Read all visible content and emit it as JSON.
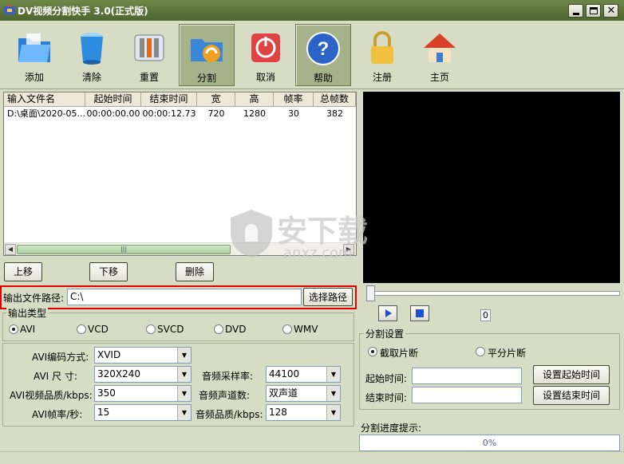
{
  "window": {
    "title": "DV视频分割快手 3.0(正式版)"
  },
  "toolbar": [
    {
      "name": "add",
      "label": "添加",
      "icon": "folder-icon"
    },
    {
      "name": "clear",
      "label": "清除",
      "icon": "bucket-icon"
    },
    {
      "name": "reset",
      "label": "重置",
      "icon": "tools-icon"
    },
    {
      "name": "split",
      "label": "分割",
      "icon": "split-icon"
    },
    {
      "name": "cancel",
      "label": "取消",
      "icon": "power-icon"
    },
    {
      "name": "help",
      "label": "帮助",
      "icon": "help-icon"
    },
    {
      "name": "register",
      "label": "注册",
      "icon": "lock-icon"
    },
    {
      "name": "home",
      "label": "主页",
      "icon": "home-icon"
    }
  ],
  "list": {
    "headers": [
      "输入文件名",
      "起始时间",
      "结束时间",
      "宽",
      "高",
      "帧率",
      "总帧数"
    ],
    "rows": [
      [
        "D:\\桌面\\2020-05...",
        "00:00:00.00",
        "00:00:12.73",
        "720",
        "1280",
        "30",
        "382"
      ]
    ]
  },
  "list_buttons": {
    "up": "上移",
    "down": "下移",
    "delete": "删除"
  },
  "output": {
    "label": "输出文件路径:",
    "path": "C:\\",
    "browse": "选择路径"
  },
  "output_type": {
    "title": "输出类型",
    "options": [
      "AVI",
      "VCD",
      "SVCD",
      "DVD",
      "WMV"
    ],
    "selected": "AVI"
  },
  "settings": {
    "codec_label": "AVI编码方式:",
    "codec": "XVID",
    "size_label": "AVI  尺  寸:",
    "size": "320X240",
    "quality_label": "AVI视频品质/kbps:",
    "quality": "350",
    "fps_label": "AVI帧率/秒:",
    "fps": "15",
    "samplerate_label": "音频采样率:",
    "samplerate": "44100",
    "channels_label": "音频声道数:",
    "channels": "双声道",
    "audioq_label": "音频品质/kbps:",
    "audioq": "128"
  },
  "player": {
    "counter": "0"
  },
  "split": {
    "title": "分割设置",
    "mode1": "截取片断",
    "mode2": "平分片断",
    "start_label": "起始时间:",
    "end_label": "结束时间:",
    "set_start": "设置起始时间",
    "set_end": "设置结束时间"
  },
  "progress": {
    "label": "分割进度提示:",
    "value": "0%"
  },
  "watermark": {
    "text": "安下载",
    "sub": "anxz.com"
  }
}
